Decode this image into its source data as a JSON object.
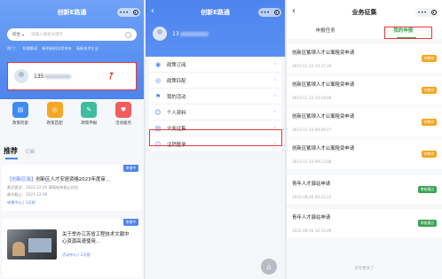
{
  "panel1": {
    "title": "创新E路通",
    "search": {
      "select_label": "综合",
      "placeholder": "请输入搜索关键字"
    },
    "hot_words": [
      "热门：",
      "权威解读",
      "新明新科技型车有",
      "高新技术企业"
    ],
    "user": {
      "phone_prefix": "135"
    },
    "services": [
      {
        "label": "政策检索",
        "icon": "search-doc-icon",
        "color": "#3d8bf5"
      },
      {
        "label": "政策匹配",
        "icon": "match-icon",
        "color": "#f5a623"
      },
      {
        "label": "政策申报",
        "icon": "apply-icon",
        "color": "#3dbd9e"
      },
      {
        "label": "活动服务",
        "icon": "activity-icon",
        "color": "#f25c5c"
      }
    ],
    "tabs": {
      "active": "推荐",
      "inactive": "订阅"
    },
    "card1": {
      "tag": "申报中",
      "title_highlight": "【创新区级】",
      "title_rest": "创新区人才安居资格2023年度审…",
      "line1": "最迟要求：2023-12-05 事情结构截止时间",
      "line2": "最终截止：2023-12-08",
      "foot": "申报中心 | 1天前"
    },
    "card2": {
      "tag": "申报中",
      "title": "关于举办江苏省工程技术文献中心资源高速使用…",
      "foot": "活动中心 | 2天前"
    }
  },
  "panel2": {
    "title": "创新E路通",
    "user": {
      "phone_prefix": "13"
    },
    "menu": [
      {
        "label": "政策订阅",
        "icon": "bell-icon",
        "glyph": "◉"
      },
      {
        "label": "政策匹配",
        "icon": "match-icon",
        "glyph": "◎"
      },
      {
        "label": "我的活动",
        "icon": "flag-icon",
        "glyph": "⚑"
      },
      {
        "label": "个人资料",
        "icon": "person-icon",
        "glyph": "☺"
      },
      {
        "label": "业务征集",
        "icon": "briefcase-icon",
        "glyph": "▤"
      },
      {
        "label": "注销登录",
        "icon": "logout-icon",
        "glyph": "⏻"
      }
    ],
    "chevron": "›",
    "home_glyph": "⌂"
  },
  "panel3": {
    "title": "业务征集",
    "tabs": [
      "申报任务",
      "我的申报"
    ],
    "active_tab": 1,
    "items": [
      {
        "title": "创新区紫琅人才公寓租赁申请",
        "date": "2023-11-22 10:37:20",
        "status": "待审核",
        "state": "pending"
      },
      {
        "title": "创新区紫琅人才公寓租赁申请",
        "date": "2023-11-22 10:18:06",
        "status": "待审核",
        "state": "pending"
      },
      {
        "title": "创新区紫琅人才公寓租赁申请",
        "date": "2023-11-10 09:29:17",
        "status": "待审核",
        "state": "pending"
      },
      {
        "title": "创新区紫琅人才公寓租赁申请",
        "date": "2023-11-10 09:23:08",
        "status": "待审核",
        "state": "pending"
      },
      {
        "title": "青年人才驿站申请",
        "date": "2022-09-26 09:33:22",
        "status": "审核通过",
        "state": "passed"
      },
      {
        "title": "青年人才驿站申请",
        "date": "2022-09-26 16:10:49",
        "status": "审核通过",
        "state": "passed"
      }
    ],
    "no_more": "没有更多了"
  },
  "colors": {
    "primary": "#4d84ee",
    "highlight_box": "#e53935",
    "success": "#3aa453",
    "pending": "#f5a623"
  }
}
